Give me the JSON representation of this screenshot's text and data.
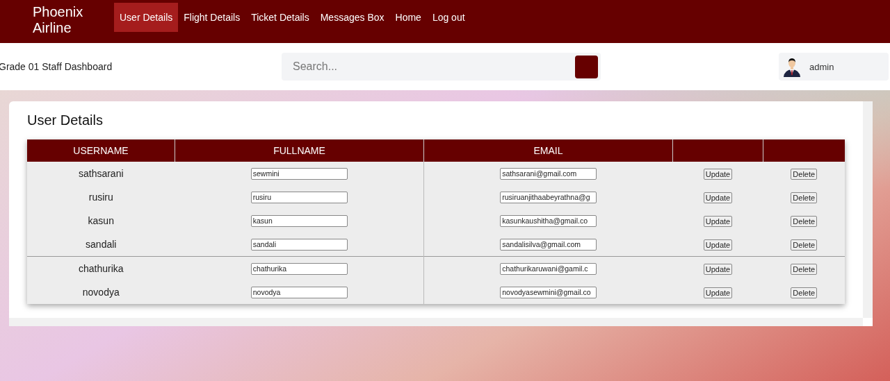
{
  "navbar": {
    "brand": "Phoenix Airline",
    "items": [
      {
        "label": "User Details",
        "selected": true
      },
      {
        "label": "Flight Details",
        "selected": false
      },
      {
        "label": "Ticket Details",
        "selected": false
      },
      {
        "label": "Messages Box",
        "selected": false
      },
      {
        "label": "Home",
        "selected": false
      },
      {
        "label": "Log out",
        "selected": false
      }
    ]
  },
  "header": {
    "title": "Grade 01 Staff Dashboard",
    "search": {
      "placeholder": "Search..."
    },
    "user": {
      "name": "admin"
    }
  },
  "panel": {
    "title": "User Details",
    "table": {
      "columns": [
        "USERNAME",
        "FULLNAME",
        "EMAIL"
      ],
      "row_groups": [
        [
          {
            "username": "sathsarani",
            "fullname": "sewmini",
            "email": "sathsarani@gmail.com",
            "update": "Update",
            "delete": "Delete"
          },
          {
            "username": "rusiru",
            "fullname": "rusiru",
            "email": "rusiruanjithaabeyrathna@g",
            "update": "Update",
            "delete": "Delete"
          },
          {
            "username": "kasun",
            "fullname": "kasun",
            "email": "kasunkaushitha@gmail.co",
            "update": "Update",
            "delete": "Delete"
          },
          {
            "username": "sandali",
            "fullname": "sandali",
            "email": "sandalisilva@gmail.com",
            "update": "Update",
            "delete": "Delete"
          }
        ],
        [
          {
            "username": "chathurika",
            "fullname": "chathurika",
            "email": "chathurikaruwani@gamil.c",
            "update": "Update",
            "delete": "Delete"
          },
          {
            "username": "novodya",
            "fullname": "novodya",
            "email": "novodyasewmini@gmail.co",
            "update": "Update",
            "delete": "Delete"
          }
        ]
      ]
    }
  }
}
